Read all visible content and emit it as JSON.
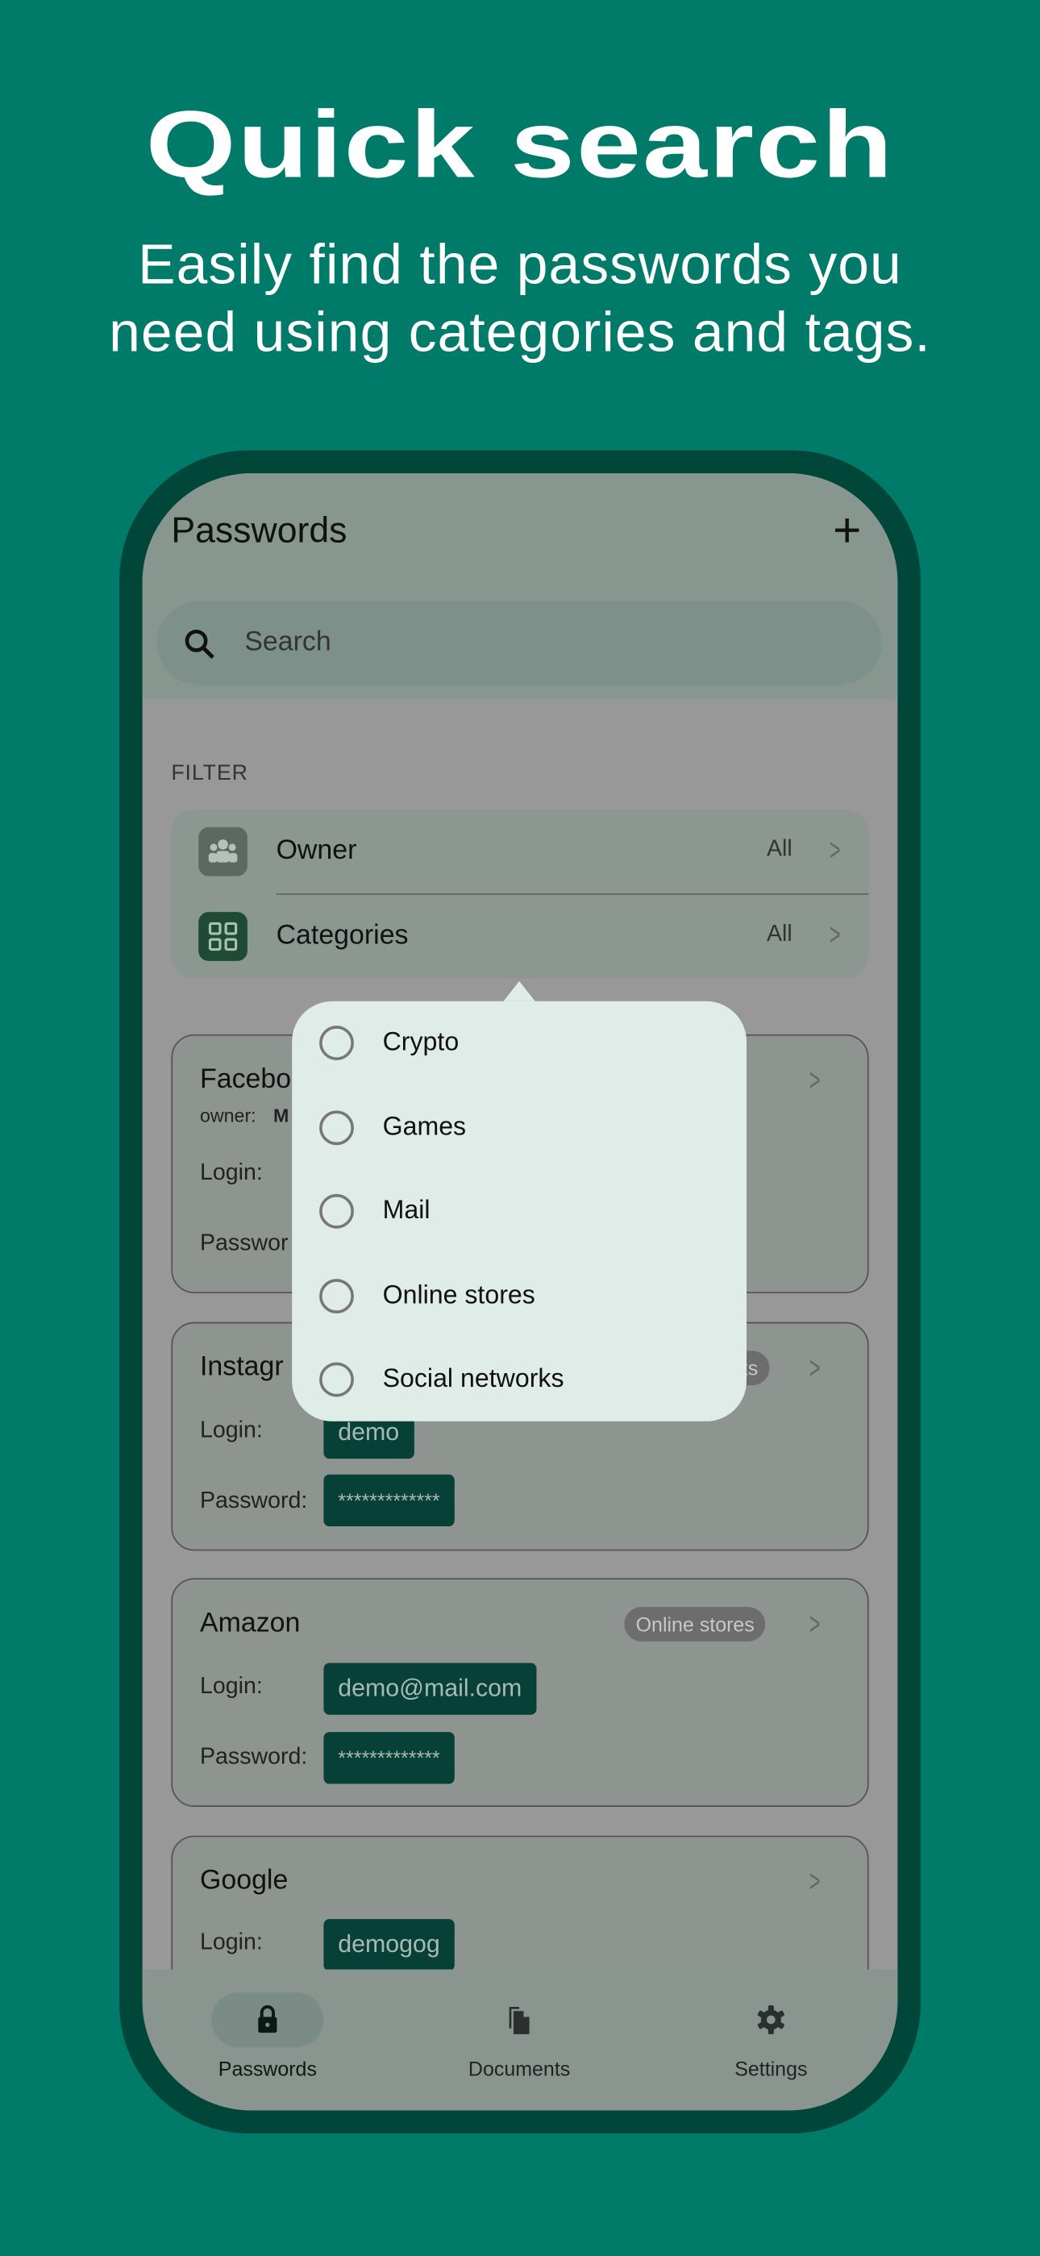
{
  "promo": {
    "headline": "Quick search",
    "subtitle_line1": "Easily find the passwords you",
    "subtitle_line2": "need using categories and tags."
  },
  "colors": {
    "background": "#007a69",
    "frame": "#00473a",
    "chip": "#074036",
    "popup": "#dfece8"
  },
  "app": {
    "title": "Passwords",
    "add_icon": "plus-icon",
    "search": {
      "placeholder": "Search"
    },
    "filter": {
      "label": "FILTER",
      "rows": [
        {
          "label": "Owner",
          "value": "All",
          "icon": "people-icon"
        },
        {
          "label": "Categories",
          "value": "All",
          "icon": "grid-icon"
        }
      ]
    },
    "cards": [
      {
        "title": "Facebo",
        "owner_label": "owner:",
        "owner_value": "M",
        "login_label": "Login:",
        "password_label": "Passwor"
      },
      {
        "title": "Instagr",
        "tag": "ks",
        "login_label": "Login:",
        "login": "demo",
        "password_label": "Password:",
        "password": "*************"
      },
      {
        "title": "Amazon",
        "tag": "Online stores",
        "login_label": "Login:",
        "login": "demo@mail.com",
        "password_label": "Password:",
        "password": "*************"
      },
      {
        "title": "Google",
        "login_label": "Login:",
        "login": "demogog"
      }
    ],
    "popup": {
      "options": [
        {
          "label": "Crypto",
          "selected": false
        },
        {
          "label": "Games",
          "selected": false
        },
        {
          "label": "Mail",
          "selected": false
        },
        {
          "label": "Online stores",
          "selected": false
        },
        {
          "label": "Social networks",
          "selected": false
        }
      ]
    },
    "nav": [
      {
        "label": "Passwords",
        "icon": "lock-icon",
        "active": true
      },
      {
        "label": "Documents",
        "icon": "documents-icon",
        "active": false
      },
      {
        "label": "Settings",
        "icon": "gear-icon",
        "active": false
      }
    ]
  }
}
